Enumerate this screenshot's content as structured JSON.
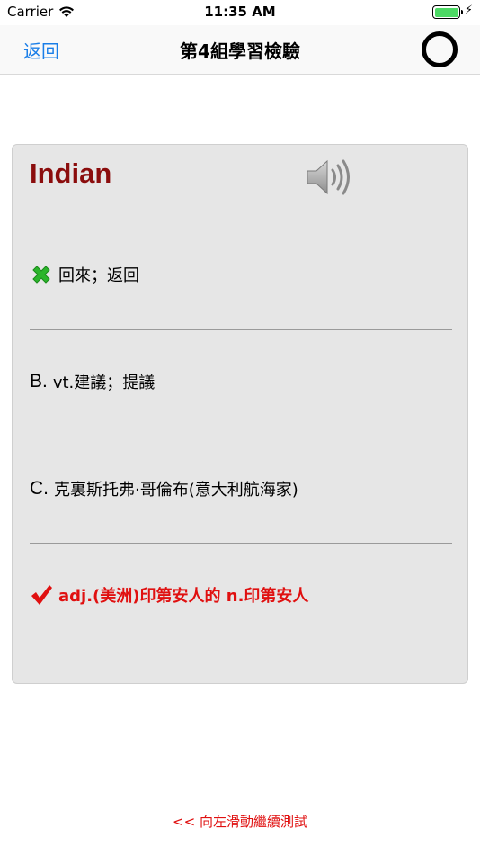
{
  "status_bar": {
    "carrier": "Carrier",
    "time": "11:35 AM",
    "battery_level": 1.0
  },
  "nav": {
    "back_label": "返回",
    "title": "第4組學習檢驗"
  },
  "quiz": {
    "word": "Indian",
    "options": [
      {
        "letter": "",
        "text": "回來；返回",
        "state": "wrong",
        "icon": "cross-icon"
      },
      {
        "letter": "B.",
        "text": "vt.建議；提議",
        "state": "none"
      },
      {
        "letter": "C.",
        "text": "克裏斯托弗·哥倫布(意大利航海家)",
        "state": "none"
      },
      {
        "letter": "",
        "text": "adj.(美洲)印第安人的 n.印第安人",
        "state": "correct",
        "icon": "checkmark-icon"
      }
    ]
  },
  "footer": {
    "swipe_hint": "<< 向左滑動繼續測試"
  },
  "colors": {
    "accent": "#1a7ee8",
    "word": "#8b0d0d",
    "correct": "#e01010",
    "wrong": "#2bb52b",
    "card_bg": "#e6e6e6"
  }
}
